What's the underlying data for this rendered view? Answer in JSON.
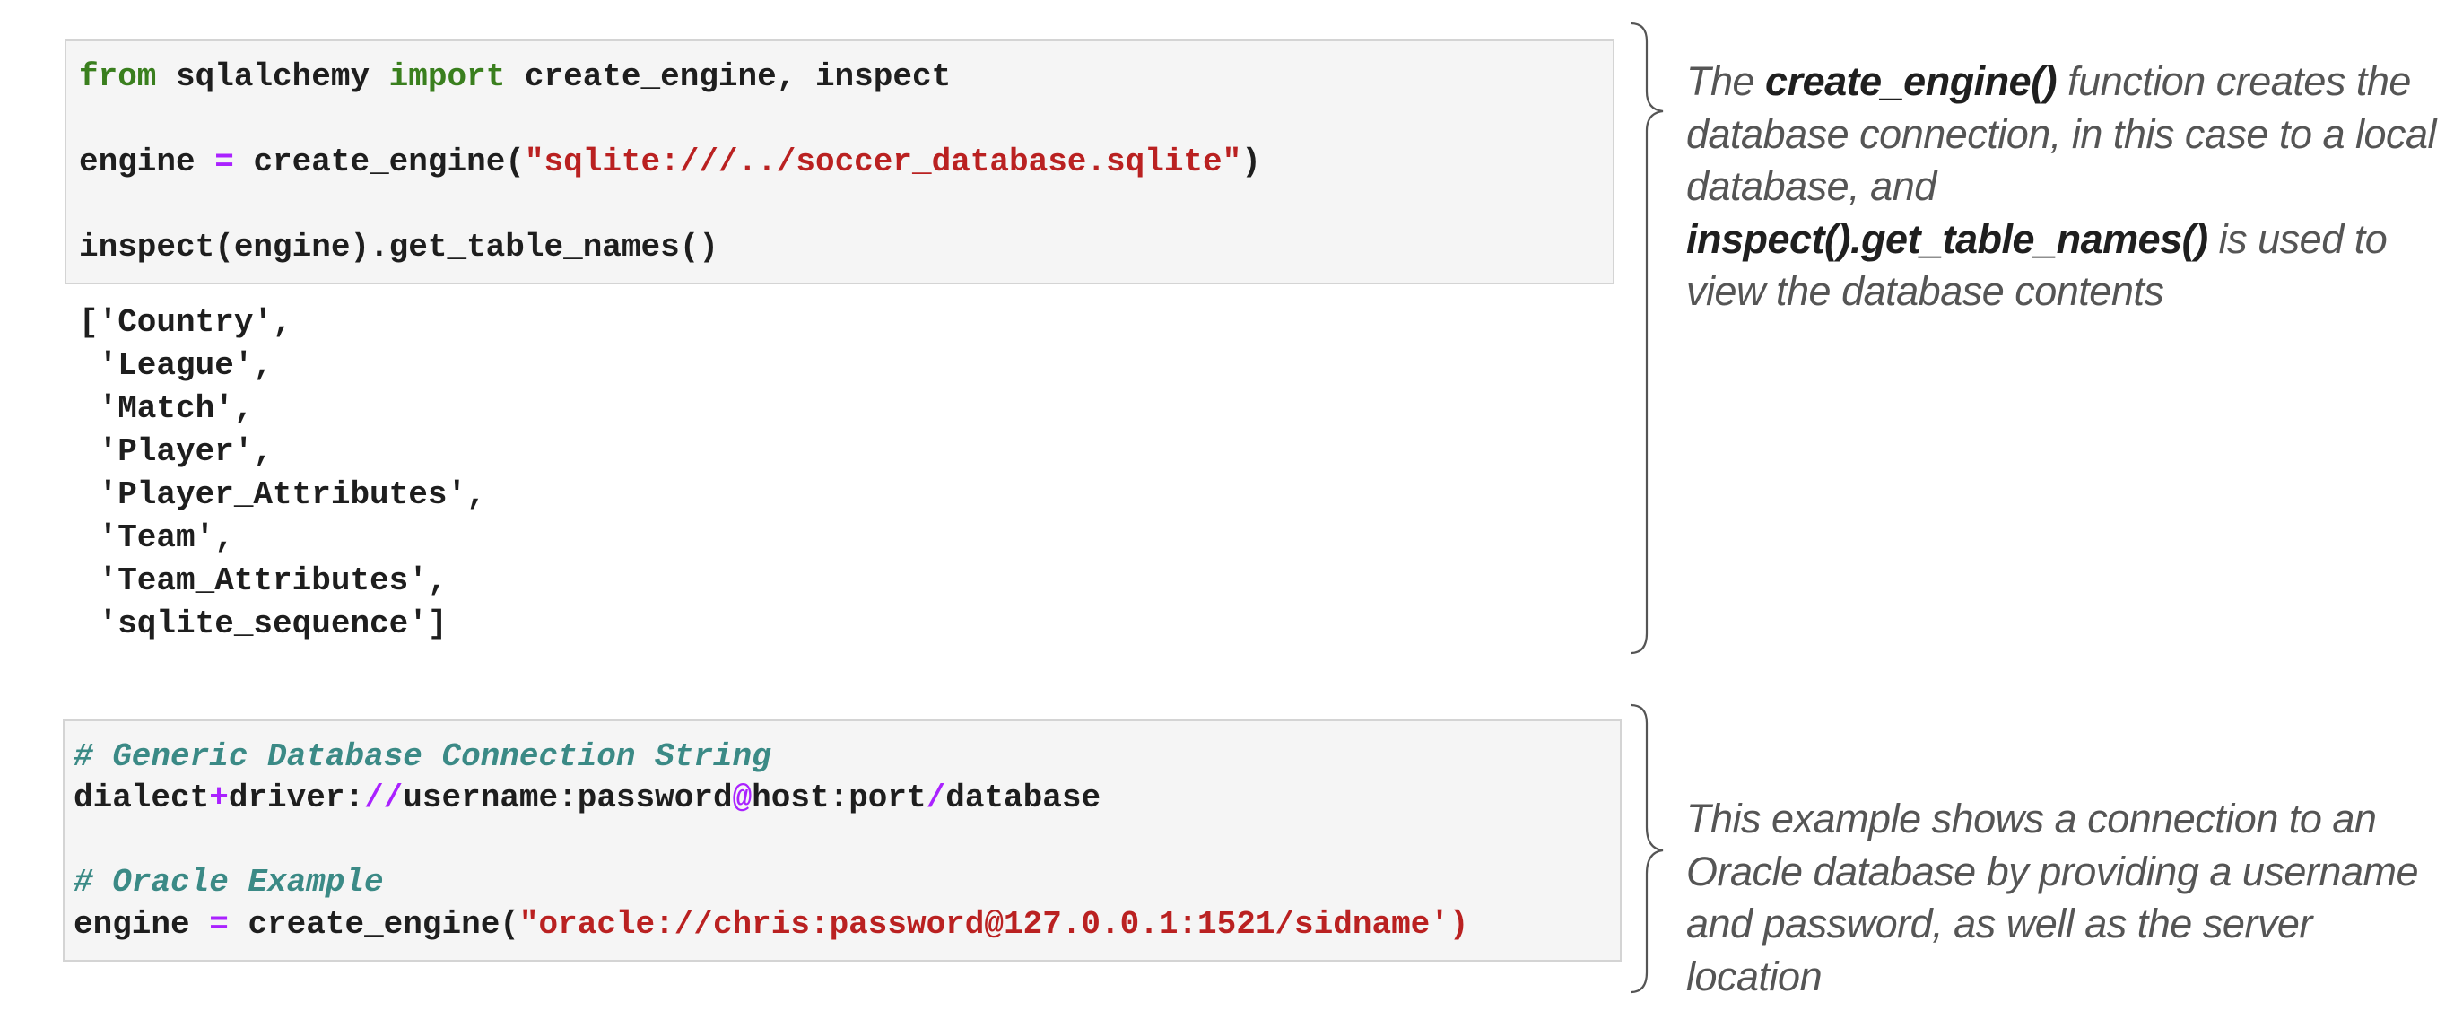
{
  "cell1": {
    "line1": {
      "kw1": "from",
      "t1": " sqlalchemy ",
      "kw2": "import",
      "t2": " create_engine, inspect"
    },
    "line2": {
      "t1": "engine ",
      "op": "=",
      "t2": " create_engine(",
      "str": "\"sqlite:///../soccer_database.sqlite\"",
      "t3": ")"
    },
    "line3": {
      "t1": "inspect(engine).get_table_names()"
    }
  },
  "output1": {
    "lines": [
      "['Country',",
      " 'League',",
      " 'Match',",
      " 'Player',",
      " 'Player_Attributes',",
      " 'Team',",
      " 'Team_Attributes',",
      " 'sqlite_sequence']"
    ]
  },
  "cell2": {
    "comment1": "# Generic Database Connection String",
    "line2": {
      "t1": "dialect",
      "op1": "+",
      "t2": "driver:",
      "op2": "//",
      "t3": "username:password",
      "op3": "@",
      "t4": "host:port",
      "op4": "/",
      "t5": "database"
    },
    "comment2": "# Oracle Example",
    "line4": {
      "t1": "engine ",
      "op": "=",
      "t2": " create_engine(",
      "str": "\"oracle://chris:password@127.0.0.1:1521/sidname')"
    }
  },
  "note1": {
    "p1": "The ",
    "b1": "create_engine()",
    "p2": " function creates the database connection, in this case to a local database, and ",
    "b2": "inspect().get_table_names()",
    "p3": " is used to view the database contents"
  },
  "note2": {
    "text": "This example shows a connection to an Oracle database by providing a username and password, as well as the server location"
  },
  "colors": {
    "keyword": "#3a7f1e",
    "operator": "#aa22ff",
    "string": "#ba2121",
    "comment": "#3b8a86",
    "cell_background": "#f5f5f5",
    "note_text": "#555555"
  }
}
